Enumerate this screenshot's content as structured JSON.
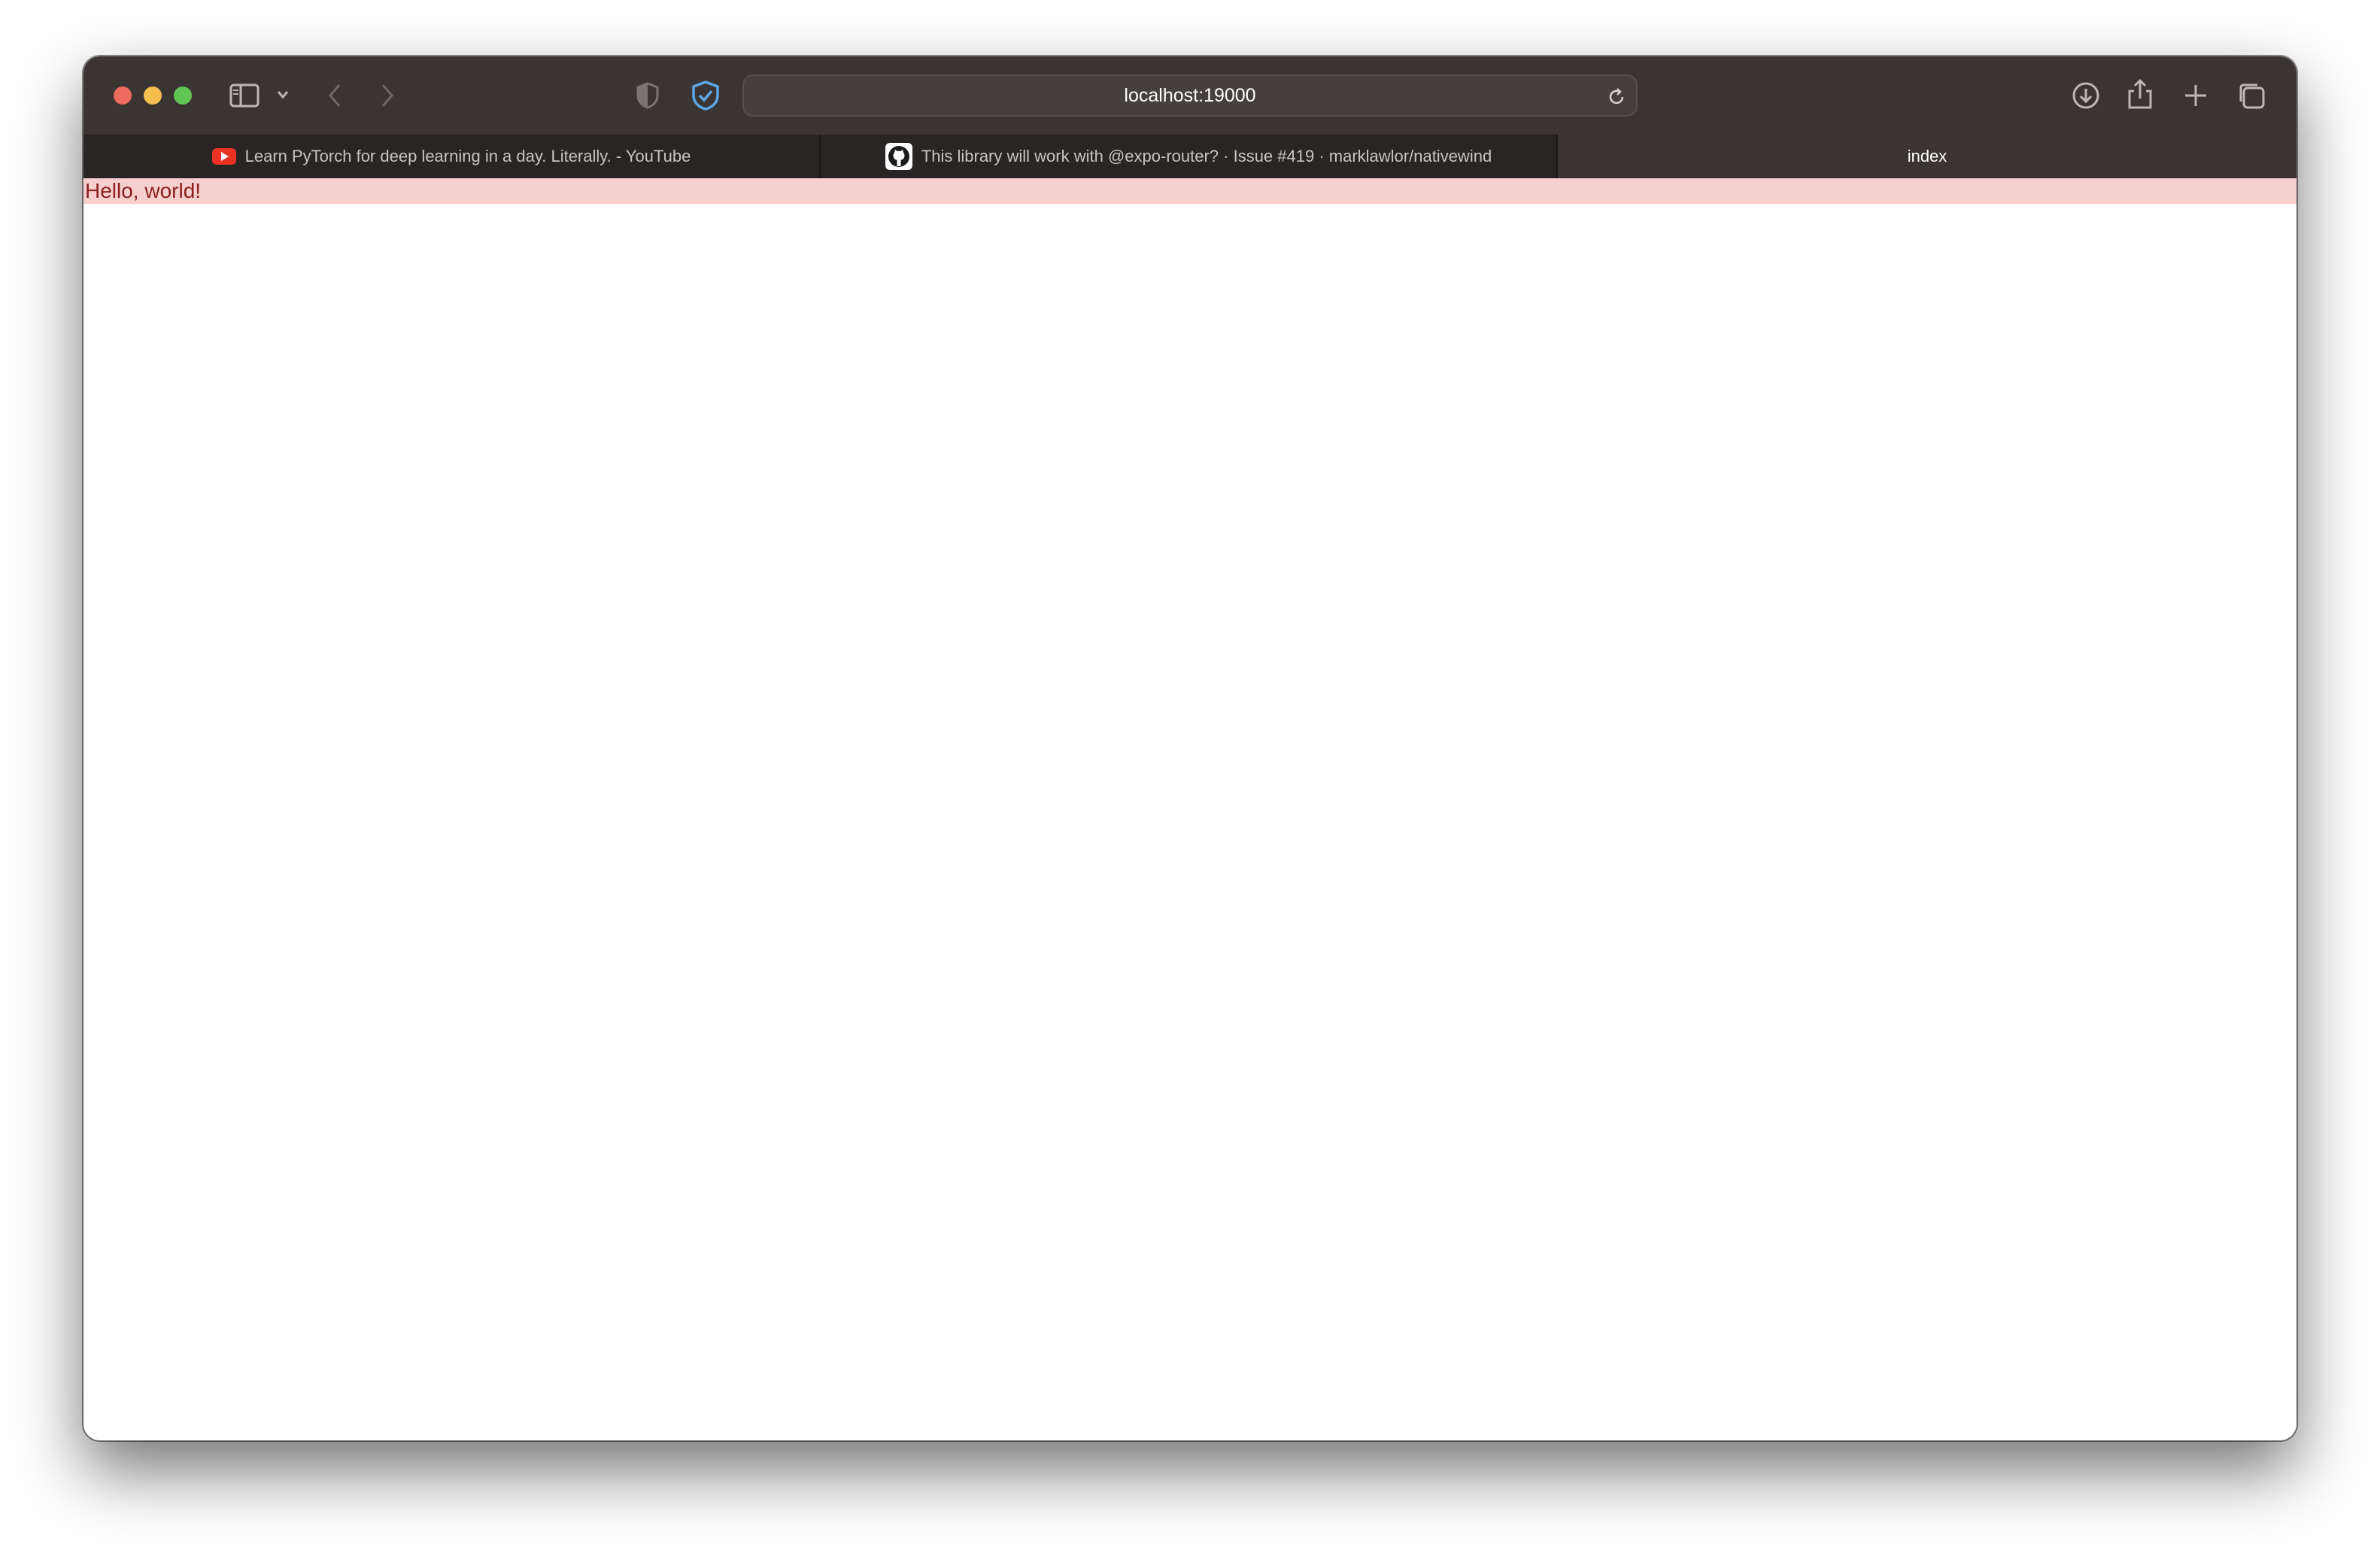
{
  "browser": {
    "address_bar": {
      "url": "localhost:19000"
    },
    "tabs": [
      {
        "label": "Learn PyTorch for deep learning in a day. Literally. - YouTube",
        "favicon": "youtube-icon",
        "active": false
      },
      {
        "label": "This library will work with @expo-router? · Issue #419 · marklawlor/nativewind",
        "favicon": "github-icon",
        "active": false
      },
      {
        "label": "index",
        "active": true
      }
    ],
    "toolbar_icons": [
      "sidebar-icon",
      "chevron-down-icon",
      "back-arrow-icon",
      "forward-arrow-icon",
      "privacy-shield-icon",
      "security-shield-check-icon",
      "reload-icon",
      "download-icon",
      "share-icon",
      "new-tab-plus-icon",
      "tab-overview-icon"
    ]
  },
  "page": {
    "text": "Hello, world!"
  },
  "colors": {
    "toolbar_bg": "#3a3533",
    "hello_bar_bg": "#f7cfcf",
    "hello_text": "#8a1f1f",
    "shield_accent": "#5aa7ea"
  }
}
